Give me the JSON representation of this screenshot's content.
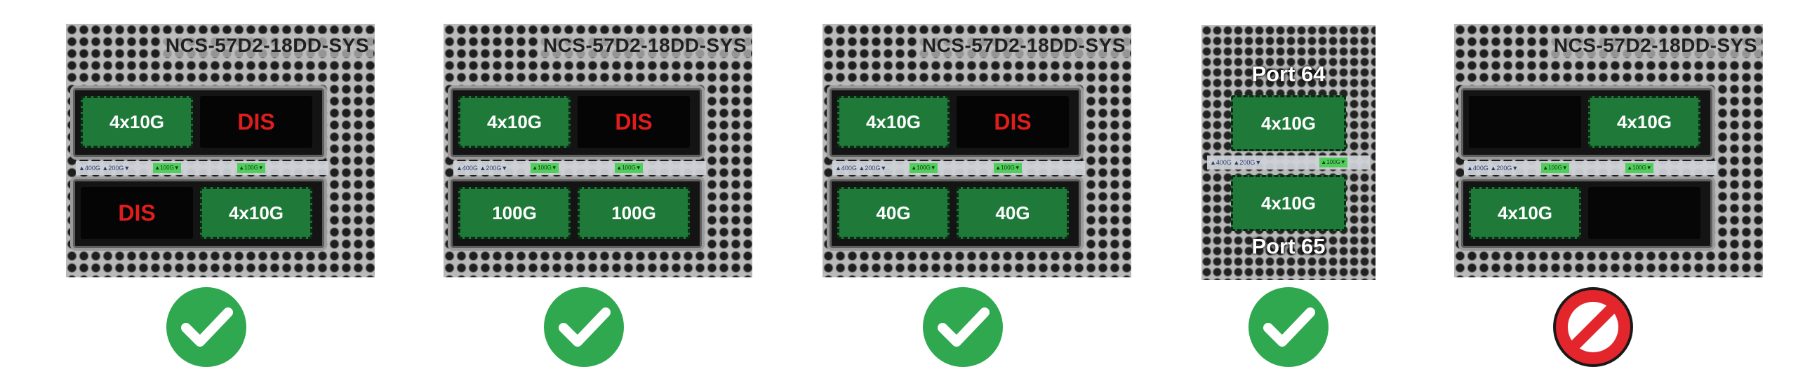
{
  "colors": {
    "module_green": "#1f7a3a",
    "disabled_text": "#e01d1d",
    "check_green": "#2fa84f",
    "prohibited_red": "#e3262b"
  },
  "model_name": "NCS-57D2-18DD-SYS",
  "label_strip": {
    "text": "▲400G ▲200G▼",
    "chip": "▲100G▼"
  },
  "panels": [
    {
      "top_left": "4x10G",
      "top_right": "DIS",
      "bottom_left": "DIS",
      "bottom_right": "4x10G",
      "status": "valid",
      "status_icon": "check-circle-icon"
    },
    {
      "top_left": "4x10G",
      "top_right": "DIS",
      "bottom_left": "100G",
      "bottom_right": "100G",
      "status": "valid",
      "status_icon": "check-circle-icon"
    },
    {
      "top_left": "4x10G",
      "top_right": "DIS",
      "bottom_left": "40G",
      "bottom_right": "40G",
      "status": "valid",
      "status_icon": "check-circle-icon"
    },
    {
      "top_port_label": "Port 64",
      "top_module": "4x10G",
      "bottom_port_label": "Port 65",
      "bottom_module": "4x10G",
      "status": "valid",
      "status_icon": "check-circle-icon"
    },
    {
      "top_left": "",
      "top_right": "4x10G",
      "bottom_left": "4x10G",
      "bottom_right": "",
      "status": "invalid",
      "status_icon": "prohibited-icon"
    }
  ]
}
